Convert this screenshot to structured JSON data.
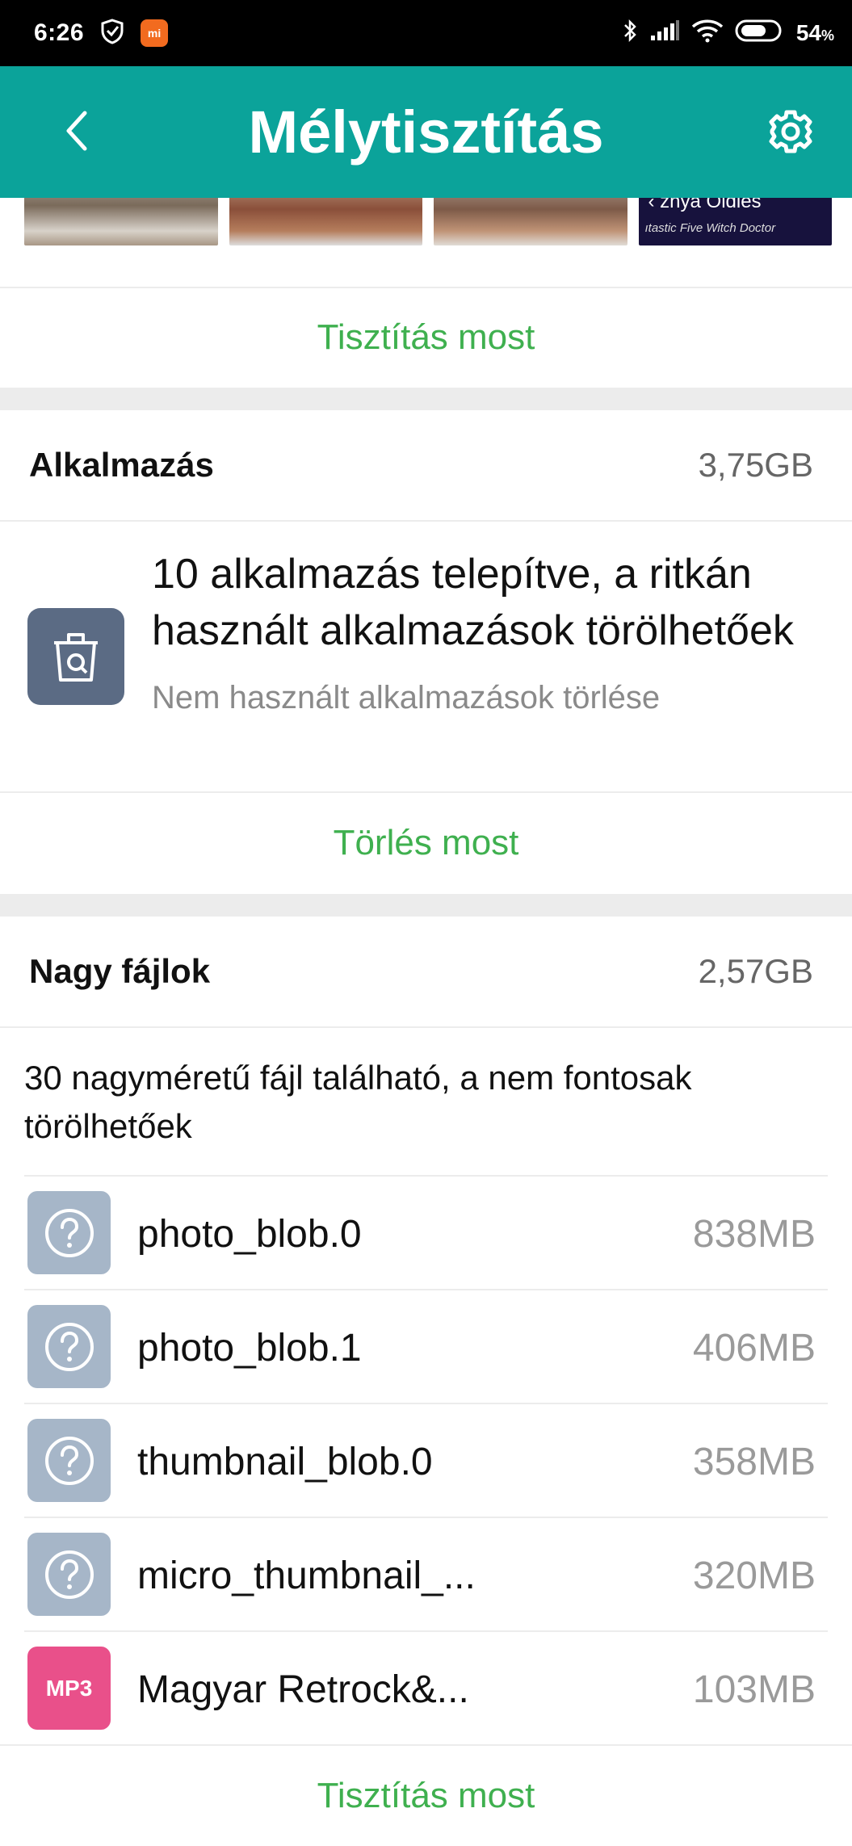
{
  "status_bar": {
    "time": "6:26",
    "battery": "54",
    "battery_unit": "%"
  },
  "header": {
    "title": "Mélytisztítás",
    "back_icon": "chevron-left-icon",
    "settings_icon": "gear-icon"
  },
  "thumbnails": {
    "last_thumb_line1": "‹ znya Oldies",
    "last_thumb_line2": "ıtastic Five   Witch Doctor"
  },
  "photos": {
    "action_label": "Tisztítás most"
  },
  "apps": {
    "title": "Alkalmazás",
    "size": "3,75GB",
    "headline": "10 alkalmazás telepítve, a ritkán használt alkalmazások törölhetőek",
    "subtitle": "Nem használt alkalmazások törlése",
    "action_label": "Törlés most"
  },
  "large_files": {
    "title": "Nagy fájlok",
    "size": "2,57GB",
    "description": "30 nagyméretű fájl található, a nem fontosak törölhetőek",
    "files": [
      {
        "name": "photo_blob.0",
        "size": "838MB",
        "icon": "unknown-file-icon"
      },
      {
        "name": "photo_blob.1",
        "size": "406MB",
        "icon": "unknown-file-icon"
      },
      {
        "name": "thumbnail_blob.0",
        "size": "358MB",
        "icon": "unknown-file-icon"
      },
      {
        "name": "micro_thumbnail_...",
        "size": "320MB",
        "icon": "unknown-file-icon"
      },
      {
        "name": "Magyar Retrock&...",
        "size": "103MB",
        "icon": "mp3-file-icon",
        "badge": "MP3"
      }
    ],
    "action_label": "Tisztítás most"
  },
  "colors": {
    "header": "#0ba39a",
    "action_green": "#3fb04f",
    "app_icon_bg": "#5b6b84",
    "unknown_icon_bg": "#a6b6c8",
    "mp3_icon_bg": "#e9508a"
  }
}
